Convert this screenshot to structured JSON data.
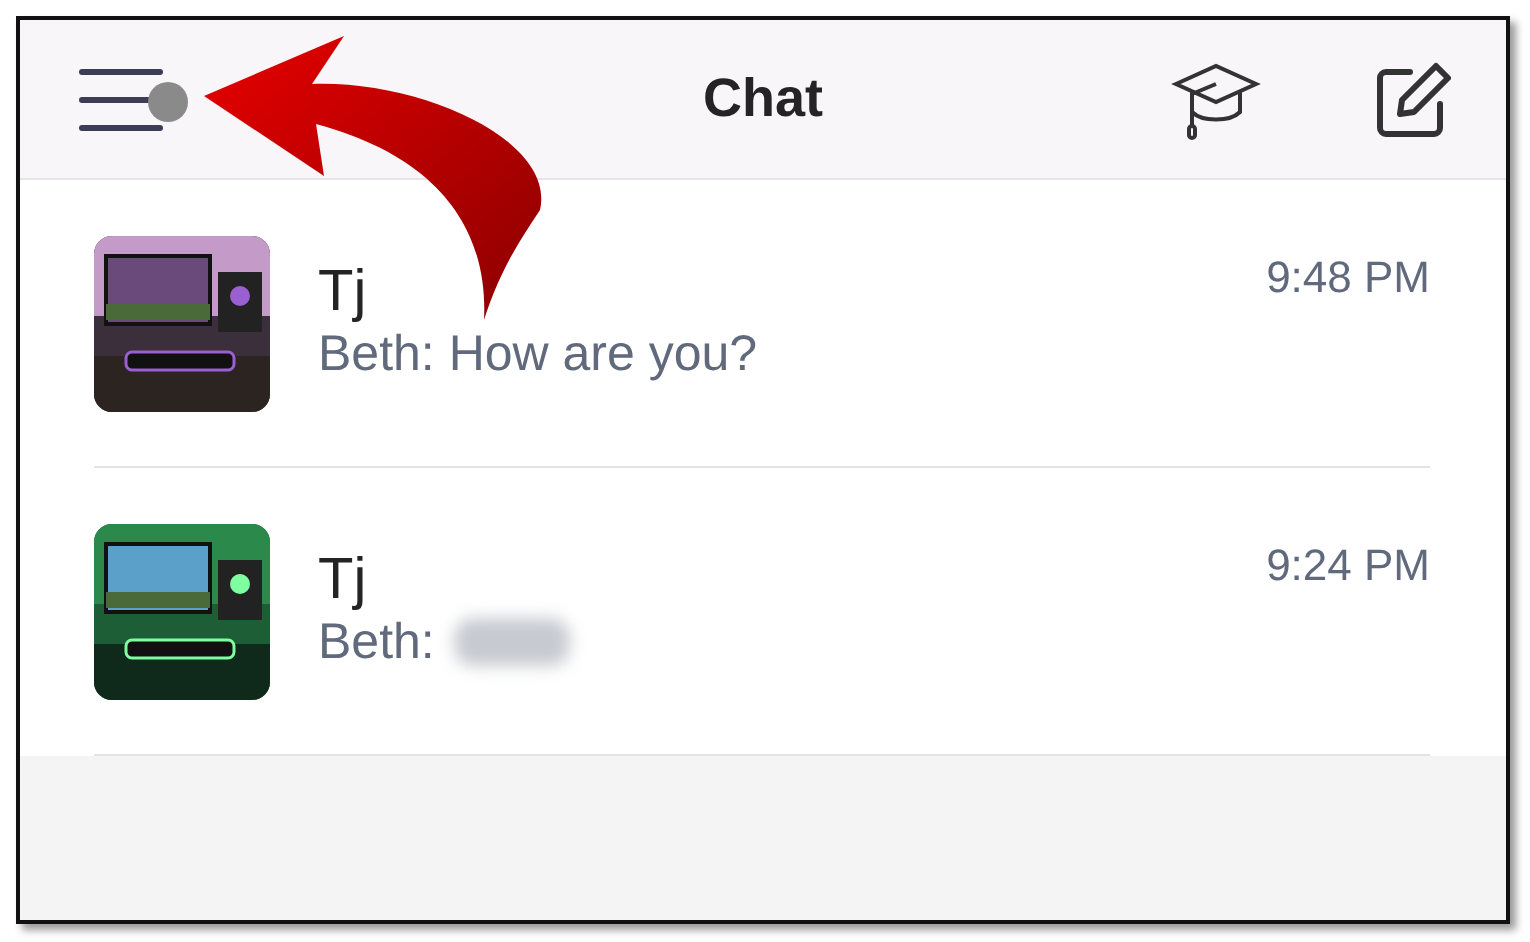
{
  "header": {
    "title": "Chat",
    "menu_badge": true
  },
  "chats": [
    {
      "name": "Tj",
      "preview": "Beth: How are you?",
      "time": "9:48 PM",
      "redacted": false
    },
    {
      "name": "Tj",
      "preview": "Beth:",
      "time": "9:24 PM",
      "redacted": true
    }
  ],
  "annotation": {
    "kind": "arrow"
  }
}
